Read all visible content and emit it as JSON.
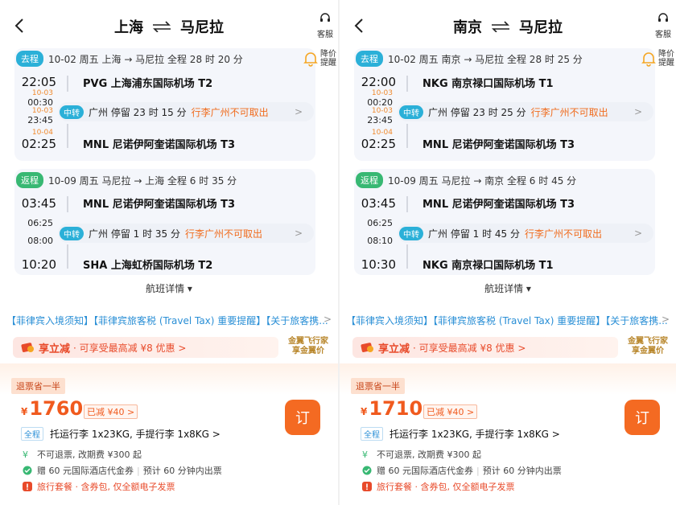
{
  "panels": [
    {
      "title_from": "上海",
      "title_to": "马尼拉",
      "service_label": "客服",
      "alert_label_1": "降价",
      "alert_label_2": "提醒",
      "outbound": {
        "tag": "去程",
        "summary": "10-02 周五   上海 → 马尼拉   全程 28 时 20 分",
        "dep_time": "22:05",
        "dep_airport": "PVG 上海浦东国际机场 T2",
        "arr1_date": "10-03",
        "arr1_time": "00:30",
        "dep2_date": "10-03",
        "dep2_time": "23:45",
        "transfer_badge": "中转",
        "transfer_text": "广州  停留 23 时 15 分",
        "transfer_warn": "行李广州不可取出",
        "arr_date": "10-04",
        "arr_time": "02:25",
        "arr_airport": "MNL 尼诺伊阿奎诺国际机场 T3"
      },
      "inbound": {
        "tag": "返程",
        "summary": "10-09 周五   马尼拉 → 上海   全程 6 时 35 分",
        "dep_time": "03:45",
        "dep_airport": "MNL 尼诺伊阿奎诺国际机场 T3",
        "arr1_time": "06:25",
        "dep2_time": "08:00",
        "transfer_badge": "中转",
        "transfer_text": "广州  停留 1 时 35 分",
        "transfer_warn": "行李广州不可取出",
        "arr_time": "10:20",
        "arr_airport": "SHA 上海虹桥国际机场 T2"
      },
      "details_label": "航班详情",
      "notice": "【菲律宾入境须知】【菲律宾旅客税 (Travel Tax) 重要提醒】【关于旅客携...",
      "promo_big": "享立减",
      "promo_rest": "· 可享受最高减 ¥8 优惠  >",
      "gold_1": "金翼飞行家",
      "gold_2": "享金翼价",
      "refund_tag": "退票省一半",
      "currency": "¥",
      "price": "1760",
      "discount": "已减  ¥40 >",
      "order_label": "订",
      "bag_all": "全程",
      "bag_text": "托运行李 1x23KG,  手提行李 1x8KG >",
      "rule_1": "不可退票,  改期费 ¥300 起",
      "rule_2a": "赠 60 元国际酒店代金券",
      "rule_2b": "预计 60 分钟内出票",
      "rule_3": "旅行套餐 · 含券包,  仅全额电子发票"
    },
    {
      "title_from": "南京",
      "title_to": "马尼拉",
      "service_label": "客服",
      "alert_label_1": "降价",
      "alert_label_2": "提醒",
      "outbound": {
        "tag": "去程",
        "summary": "10-02 周五   南京 → 马尼拉   全程 28 时 25 分",
        "dep_time": "22:00",
        "dep_airport": "NKG 南京禄口国际机场 T1",
        "arr1_date": "10-03",
        "arr1_time": "00:20",
        "dep2_date": "10-03",
        "dep2_time": "23:45",
        "transfer_badge": "中转",
        "transfer_text": "广州  停留 23 时 25 分",
        "transfer_warn": "行李广州不可取出",
        "arr_date": "10-04",
        "arr_time": "02:25",
        "arr_airport": "MNL 尼诺伊阿奎诺国际机场 T3"
      },
      "inbound": {
        "tag": "返程",
        "summary": "10-09 周五   马尼拉 → 南京   全程 6 时 45 分",
        "dep_time": "03:45",
        "dep_airport": "MNL 尼诺伊阿奎诺国际机场 T3",
        "arr1_time": "06:25",
        "dep2_time": "08:10",
        "transfer_badge": "中转",
        "transfer_text": "广州  停留 1 时 45 分",
        "transfer_warn": "行李广州不可取出",
        "arr_time": "10:30",
        "arr_airport": "NKG 南京禄口国际机场 T1"
      },
      "details_label": "航班详情",
      "notice": "【菲律宾入境须知】【菲律宾旅客税 (Travel Tax) 重要提醒】【关于旅客携...",
      "promo_big": "享立减",
      "promo_rest": "· 可享受最高减 ¥8 优惠  >",
      "gold_1": "金翼飞行家",
      "gold_2": "享金翼价",
      "refund_tag": "退票省一半",
      "currency": "¥",
      "price": "1710",
      "discount": "已减  ¥40 >",
      "order_label": "订",
      "bag_all": "全程",
      "bag_text": "托运行李 1x23KG,  手提行李 1x8KG >",
      "rule_1": "不可退票,  改期费 ¥300 起",
      "rule_2a": "赠 60 元国际酒店代金券",
      "rule_2b": "预计 60 分钟内出票",
      "rule_3": "旅行套餐 · 含券包,  仅全额电子发票"
    }
  ],
  "colors": {
    "accent_orange": "#f46a22",
    "price_red": "#f05a1e",
    "outbound_tag": "#2bb0d8",
    "return_tag": "#38b873",
    "link_blue": "#2a8fd6"
  },
  "icons": [
    "back-icon",
    "swap-icon",
    "headset-icon",
    "bell-icon",
    "chevron-right-icon",
    "caret-down-icon",
    "coupon-icon",
    "yen-icon",
    "check-icon",
    "exclaim-icon"
  ]
}
